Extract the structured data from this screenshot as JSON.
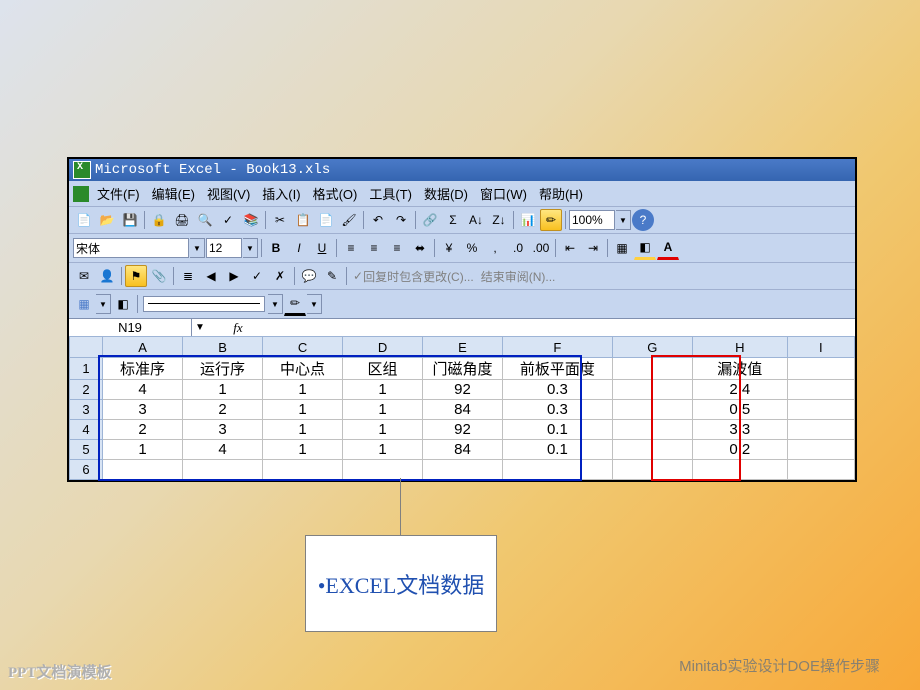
{
  "title": "Microsoft Excel - Book13.xls",
  "menu": {
    "file": "文件(F)",
    "edit": "编辑(E)",
    "view": "视图(V)",
    "insert": "插入(I)",
    "format": "格式(O)",
    "tools": "工具(T)",
    "data": "数据(D)",
    "window": "窗口(W)",
    "help": "帮助(H)"
  },
  "font": {
    "name": "宋体",
    "size": "12"
  },
  "zoom": "100%",
  "review": {
    "reply": "回复时包含更改(C)...",
    "end": "结束审阅(N)..."
  },
  "namebox": "N19",
  "columns": [
    "A",
    "B",
    "C",
    "D",
    "E",
    "F",
    "G",
    "H",
    "I"
  ],
  "rows": [
    "1",
    "2",
    "3",
    "4",
    "5",
    "6"
  ],
  "headers": {
    "A": "标准序",
    "B": "运行序",
    "C": "中心点",
    "D": "区组",
    "E": "门磁角度",
    "F": "前板平面度",
    "H": "漏波值"
  },
  "data": [
    {
      "A": "4",
      "B": "1",
      "C": "1",
      "D": "1",
      "E": "92",
      "F": "0.3",
      "H": "2.4"
    },
    {
      "A": "3",
      "B": "2",
      "C": "1",
      "D": "1",
      "E": "84",
      "F": "0.3",
      "H": "0.5"
    },
    {
      "A": "2",
      "B": "3",
      "C": "1",
      "D": "1",
      "E": "92",
      "F": "0.1",
      "H": "3.3"
    },
    {
      "A": "1",
      "B": "4",
      "C": "1",
      "D": "1",
      "E": "84",
      "F": "0.1",
      "H": "0.2"
    }
  ],
  "callout": "•EXCEL文档数据",
  "footer_left": "PPT文档演模板",
  "footer_right": "Minitab实验设计DOE操作步骤"
}
